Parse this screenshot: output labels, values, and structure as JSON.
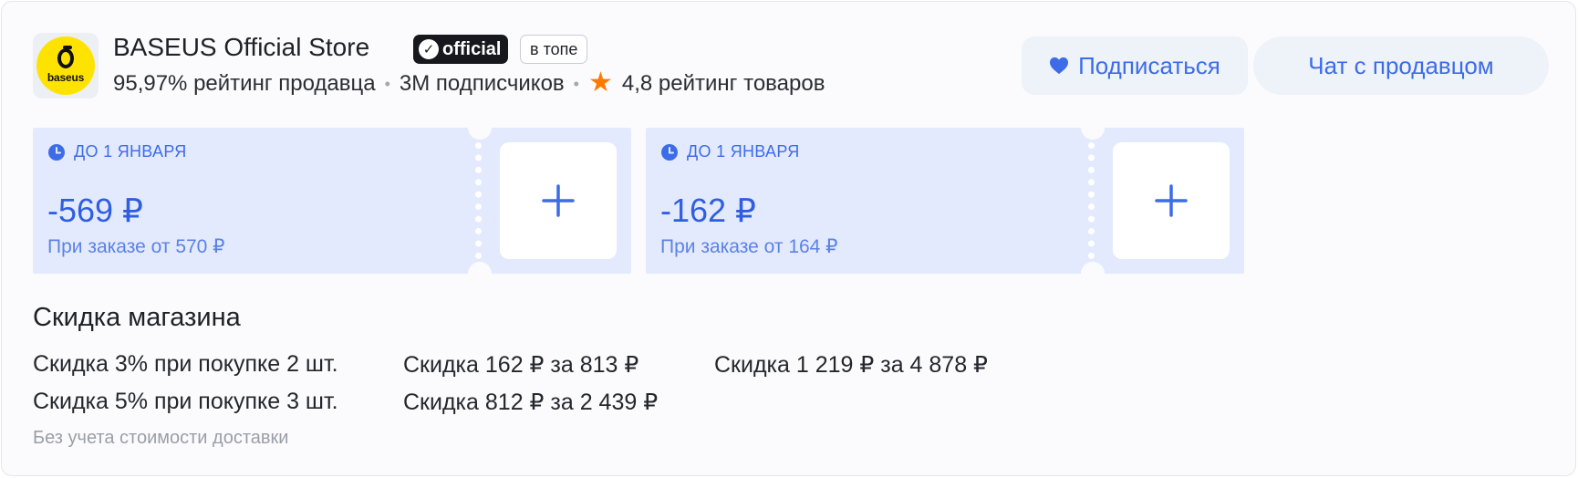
{
  "store": {
    "logo_text": "baseus",
    "name": "BASEUS Official Store",
    "official_label": "official",
    "top_label": "в топе",
    "seller_rating": "95,97% рейтинг продавца",
    "subscribers": "3M подписчиков",
    "product_rating": "4,8 рейтинг товаров"
  },
  "actions": {
    "subscribe_label": "Подписаться",
    "chat_label": "Чат с продавцом"
  },
  "coupons": [
    {
      "deadline": "ДО 1 ЯНВАРЯ",
      "amount": "-569 ₽",
      "condition": "При заказе от 570 ₽"
    },
    {
      "deadline": "ДО 1 ЯНВАРЯ",
      "amount": "-162 ₽",
      "condition": "При заказе от 164 ₽"
    }
  ],
  "store_discount": {
    "title": "Скидка магазина",
    "items": [
      "Скидка 3% при покупке 2 шт.",
      "Скидка 162 ₽ за 813 ₽",
      "Скидка 1 219 ₽ за 4 878 ₽",
      "Скидка 5% при покупке 3 шт.",
      "Скидка 812 ₽ за 2 439 ₽"
    ],
    "note": "Без учета стоимости доставки"
  },
  "colors": {
    "accent": "#3d6ce8",
    "coupon_bg": "#e4eafd",
    "logo_bg": "#ffe300",
    "star": "#ff7a00"
  },
  "icons": [
    "heart-icon",
    "clock-icon",
    "plus-icon",
    "star-icon",
    "check-icon"
  ]
}
